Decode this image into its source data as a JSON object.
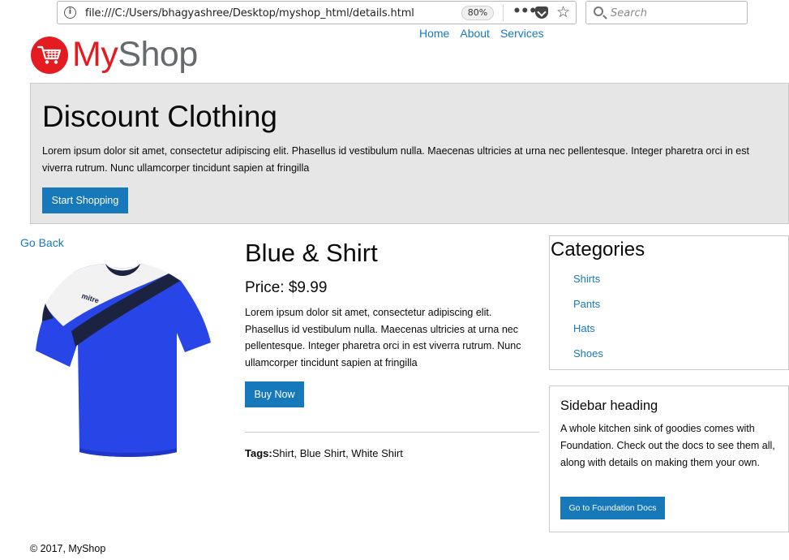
{
  "browser": {
    "url": "file:///C:/Users/bhagyashree/Desktop/myshop_html/details.html",
    "zoom": "80%",
    "search_placeholder": "Search"
  },
  "header": {
    "brand_part1": "My",
    "brand_part2": "Shop",
    "nav": [
      "Home",
      "About",
      "Services"
    ]
  },
  "hero": {
    "title": "Discount Clothing",
    "text": "Lorem ipsum dolor sit amet, consectetur adipiscing elit. Phasellus id vestibulum nulla. Maecenas ultricies at urna nec pellentesque. Integer pharetra orci in est viverra rutrum. Nunc ullamcorper tincidunt sapien at fringilla",
    "button": "Start Shopping"
  },
  "back_link": "Go Back",
  "product": {
    "image_brand_text": "mitre",
    "title": "Blue & Shirt",
    "price": "Price: $9.99",
    "description": "Lorem ipsum dolor sit amet, consectetur adipiscing elit. Phasellus id vestibulum nulla. Maecenas ultricies at urna nec pellentesque. Integer pharetra orci in est viverra rutrum. Nunc ullamcorper tincidunt sapien at fringilla",
    "buy_button": "Buy Now",
    "tags_label": "Tags:",
    "tags": [
      "Shirt",
      "Blue Shirt",
      "White Shirt"
    ]
  },
  "categories": {
    "title": "Categories",
    "items": [
      "Shirts",
      "Pants",
      "Hats",
      "Shoes"
    ]
  },
  "sidebar": {
    "heading": "Sidebar heading",
    "text": "A whole kitchen sink of goodies comes with Foundation. Check out the docs to see them all, along with details on making them your own.",
    "button": "Go to Foundation Docs"
  },
  "footer": "© 2017, MyShop",
  "colors": {
    "link": "#1779ba",
    "brand_red": "#e41c22",
    "brand_gray": "#666a6d",
    "hero_bg": "#e6e6e6"
  }
}
